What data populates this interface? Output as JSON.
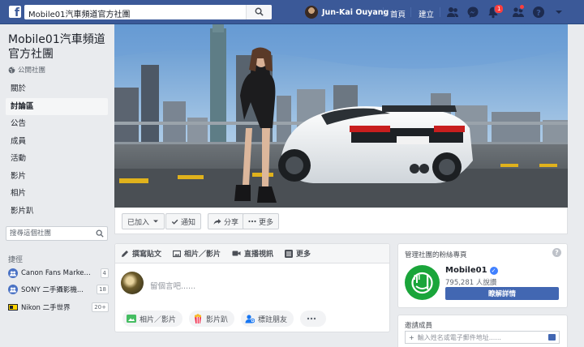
{
  "topbar": {
    "search_value": "Mobile01汽車頻道官方社團",
    "user_name": "Jun-Kai Ouyang",
    "nav_home": "首頁",
    "nav_create": "建立",
    "notification_count": "1",
    "colors": {
      "bar": "#3b5998",
      "badge": "#fa3e3e"
    }
  },
  "group": {
    "title": "Mobile01汽車頻道官方社團",
    "privacy": "公開社團"
  },
  "left_nav": {
    "items": [
      "關於",
      "討論區",
      "公告",
      "成員",
      "活動",
      "影片",
      "相片",
      "影片趴"
    ],
    "active_index": 1,
    "search_placeholder": "搜尋這個社團"
  },
  "shortcuts": {
    "label": "捷徑",
    "items": [
      {
        "label": "Canon Fans Marke...",
        "count": "4",
        "icon": "group-icon"
      },
      {
        "label": "SONY 二手攝影機...",
        "count": "18",
        "icon": "group-icon"
      },
      {
        "label": "Nikon 二手世界",
        "count": "20+",
        "icon": "page-icon"
      }
    ]
  },
  "actions": {
    "joined": "已加入",
    "notify": "通知",
    "share": "分享",
    "more": "更多"
  },
  "composer": {
    "tabs": [
      "撰寫貼文",
      "相片／影片",
      "直播視訊",
      "更多"
    ],
    "placeholder": "留個言吧......",
    "buttons": [
      "相片／影片",
      "影片趴",
      "標註朋友"
    ]
  },
  "linked_page": {
    "section_label": "管理社團的粉絲專頁",
    "name": "Mobile01",
    "likes": "795,281 人說讚",
    "button": "瞭解詳情",
    "brand_color": "#1aa53a"
  },
  "invite": {
    "label": "邀請成員",
    "placeholder": "輸入姓名或電子郵件地址......"
  }
}
